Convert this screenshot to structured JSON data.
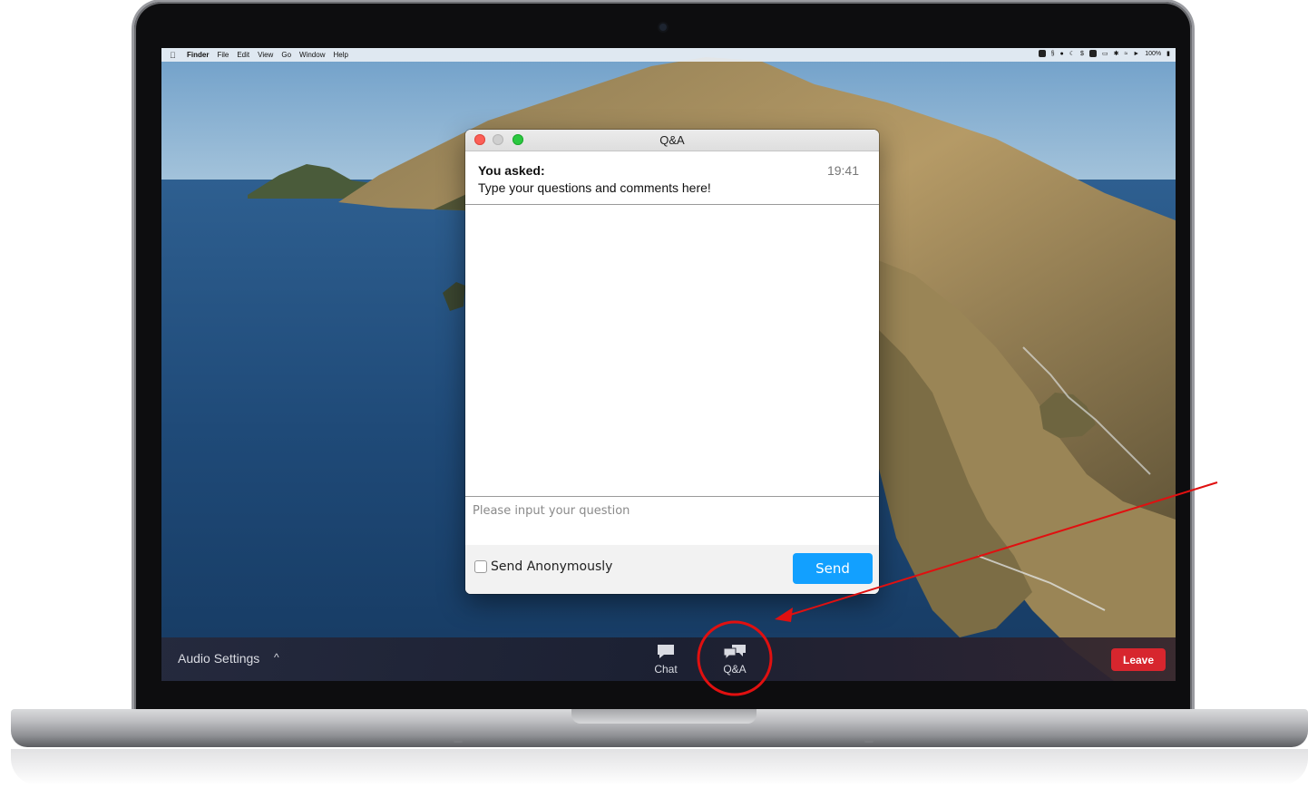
{
  "menubar": {
    "apple_icon": "apple-icon",
    "app_name": "Finder",
    "items": [
      "File",
      "Edit",
      "View",
      "Go",
      "Window",
      "Help"
    ],
    "battery": "100%"
  },
  "qa_window": {
    "title": "Q&A",
    "asked_label": "You asked:",
    "asked_time": "19:41",
    "asked_text": "Type your questions and comments here!",
    "input_placeholder": "Please input your question",
    "anonymous_label": "Send Anonymously",
    "send_label": "Send"
  },
  "toolbar": {
    "audio_settings_label": "Audio Settings",
    "audio_caret": "^",
    "chat_label": "Chat",
    "qa_label": "Q&A",
    "leave_label": "Leave"
  },
  "colors": {
    "accent_send": "#12a0ff",
    "leave": "#d7262e",
    "annotation": "#e01010"
  }
}
